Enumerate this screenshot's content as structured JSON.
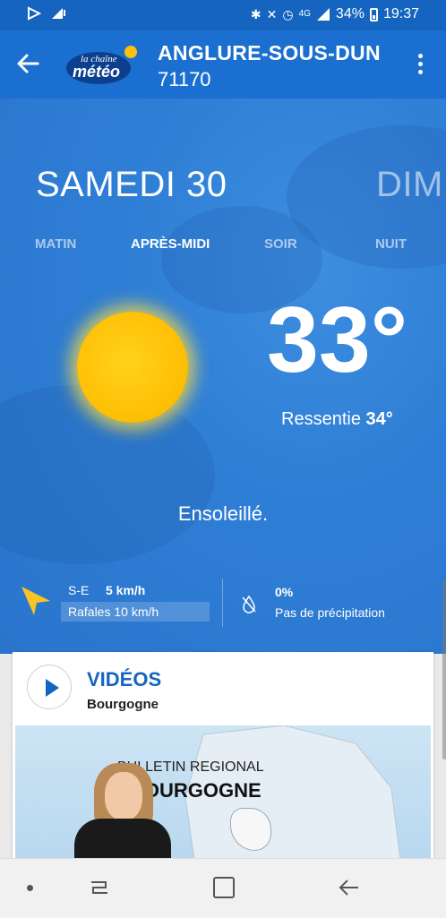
{
  "status_bar": {
    "battery": "34%",
    "time": "19:37",
    "network": "4G"
  },
  "app_bar": {
    "logo_line1": "la chaîne",
    "logo_line2": "météo",
    "location_name": "ANGLURE-SOUS-DUN",
    "postal_code": "71170"
  },
  "forecast": {
    "current_day": "SAMEDI 30",
    "next_day": "DIM",
    "periods": [
      "MATIN",
      "APRÈS-MIDI",
      "SOIR",
      "NUIT"
    ],
    "active_period": "APRÈS-MIDI",
    "temperature": "33°",
    "feels_like_label": "Ressentie",
    "feels_like_value": "34°",
    "condition": "Ensoleillé.",
    "wind_direction": "S-E",
    "wind_speed": "5 km/h",
    "gusts": "Rafales 10 km/h",
    "precip_percent": "0%",
    "precip_text": "Pas de précipitation"
  },
  "videos_card": {
    "title": "VIDÉOS",
    "region": "Bourgogne",
    "thumbnail_line1": "BULLETIN REGIONAL",
    "thumbnail_line2": "BOURGOGNE"
  },
  "colors": {
    "app_bar": "#1a6fd0",
    "accent": "#1565c0",
    "sun": "#ffc107",
    "wind_arrow": "#f7c325"
  }
}
